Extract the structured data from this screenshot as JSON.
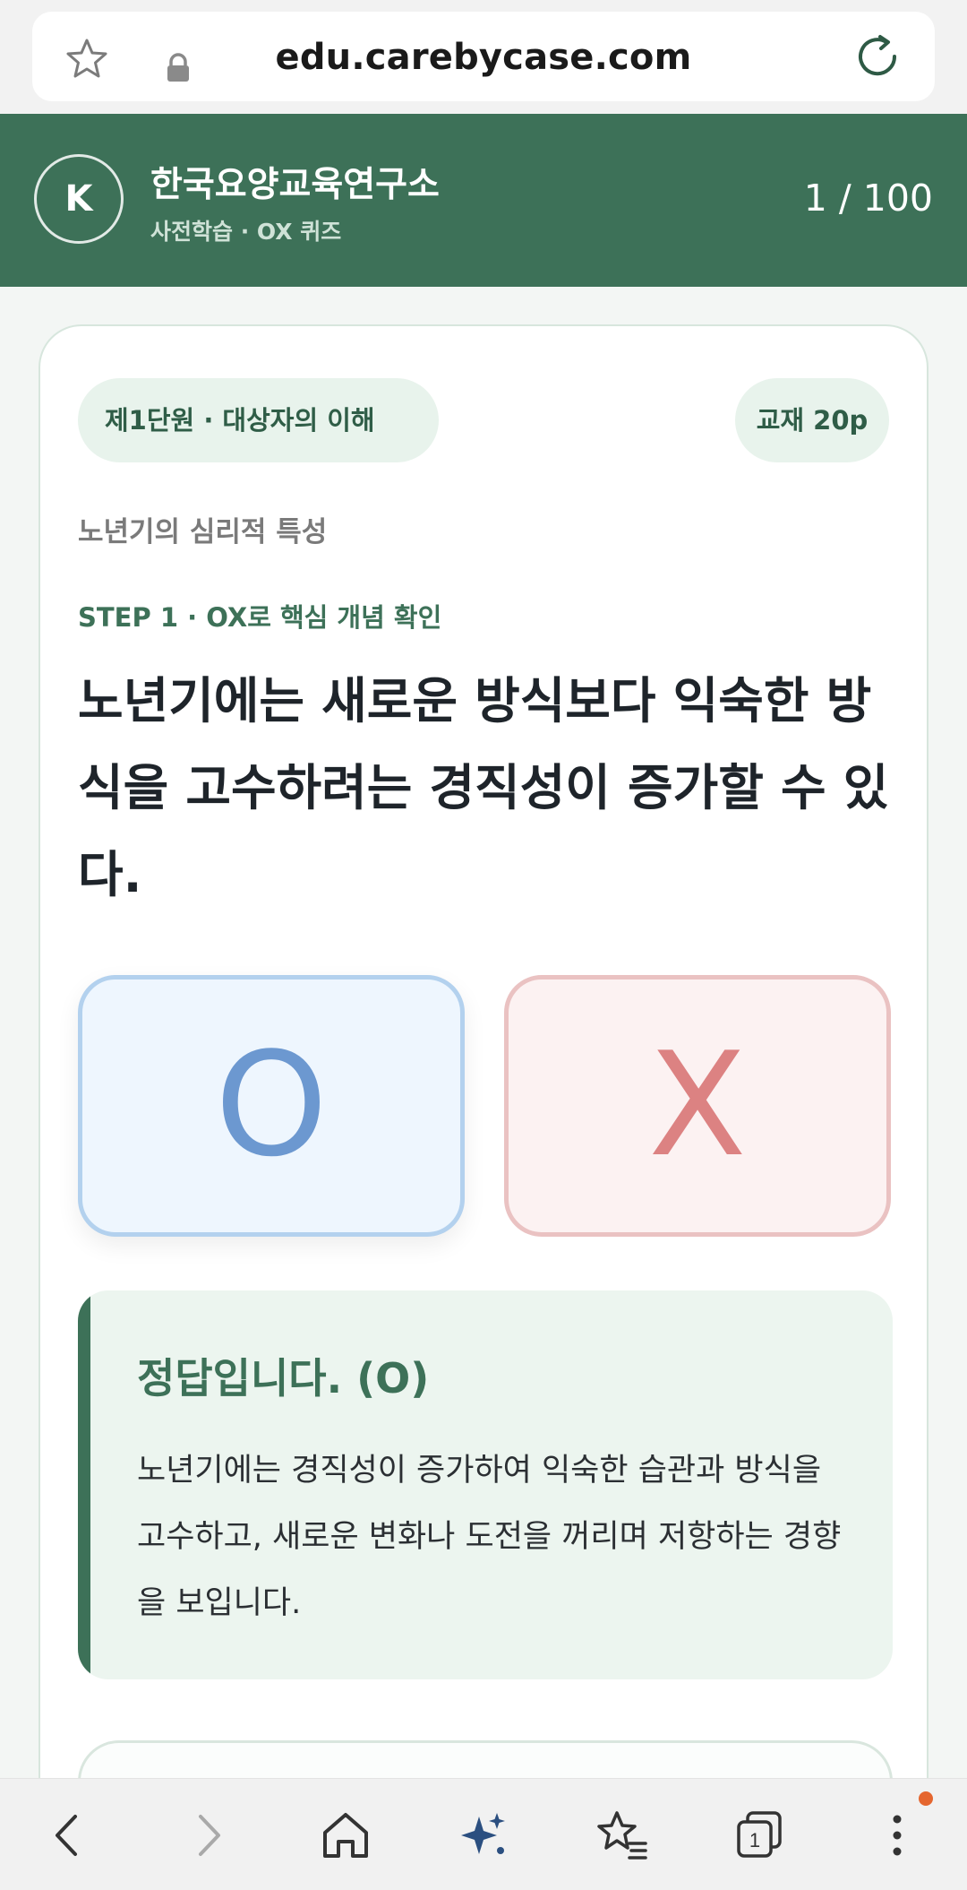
{
  "browser": {
    "url": "edu.carebycase.com"
  },
  "header": {
    "avatar_initial": "K",
    "title": "한국요양교육연구소",
    "subtitle": "사전학습 · OX 퀴즈",
    "progress": "1 / 100"
  },
  "quiz": {
    "unit_chip": "제1단원 · 대상자의 이해",
    "page_chip": "교재 20p",
    "topic": "노년기의 심리적 특성",
    "step": "STEP 1 · OX로 핵심 개념 확인",
    "question": "노년기에는 새로운 방식보다 익숙한 방식을 고수하려는 경직성이 증가할 수 있다.",
    "option_o": "O",
    "option_x": "X",
    "feedback_title": "정답입니다. (O)",
    "feedback_text": "노년기에는 경직성이 증가하여 익숙한 습관과 방식을 고수하고, 새로운 변화나 도전을 꺼리며 저항하는 경향을 보입니다."
  },
  "bottom_nav": {
    "tab_count": "1"
  },
  "colors": {
    "brand_green": "#3d7158",
    "o_blue": "#6c98d0",
    "x_red": "#dc8282",
    "notification_dot": "#e5662f"
  }
}
